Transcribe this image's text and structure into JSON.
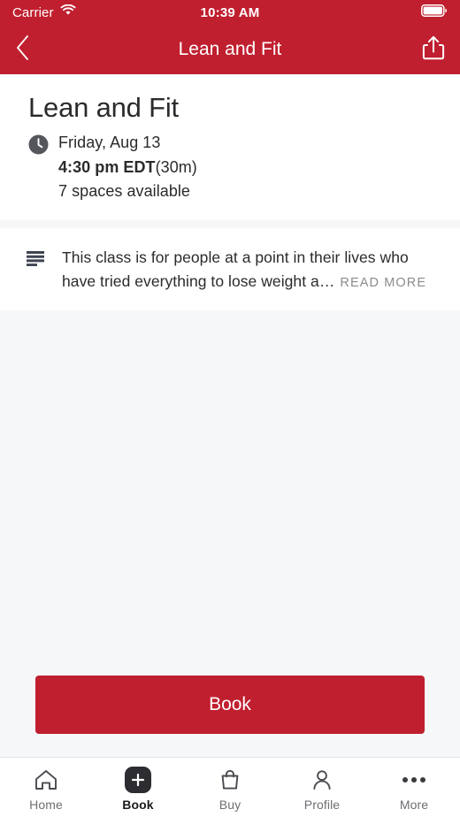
{
  "colors": {
    "brand_red": "#C01F2F",
    "page_background": "#F6F7F9",
    "card_background": "#FFFFFF",
    "text_primary": "#2B2B2E",
    "text_muted": "#8B8B90",
    "tab_active": "#1C1C1F",
    "tab_inactive": "#6E6E73",
    "book_chip": "#2C2C31"
  },
  "status_bar": {
    "carrier": "Carrier",
    "wifi_icon": "wifi-icon",
    "time": "10:39 AM",
    "battery_icon": "battery-full-icon"
  },
  "nav_bar": {
    "back_icon": "chevron-left-icon",
    "title": "Lean and Fit",
    "share_icon": "share-icon"
  },
  "class_info": {
    "title": "Lean and Fit",
    "clock_icon": "clock-icon",
    "date": "Friday, Aug 13",
    "time": "4:30 pm EDT",
    "duration": "(30m)",
    "availability": "7 spaces available"
  },
  "description": {
    "icon": "description-lines-icon",
    "text": "This class is for people at a point in their lives who have tried everything to lose weight a…",
    "read_more_label": "READ MORE"
  },
  "primary_action": {
    "book_label": "Book"
  },
  "tab_bar": {
    "items": [
      {
        "label": "Home",
        "icon": "home-icon",
        "active": false
      },
      {
        "label": "Book",
        "icon": "plus-icon",
        "active": true
      },
      {
        "label": "Buy",
        "icon": "bag-icon",
        "active": false
      },
      {
        "label": "Profile",
        "icon": "person-icon",
        "active": false
      },
      {
        "label": "More",
        "icon": "ellipsis-icon",
        "active": false
      }
    ]
  }
}
